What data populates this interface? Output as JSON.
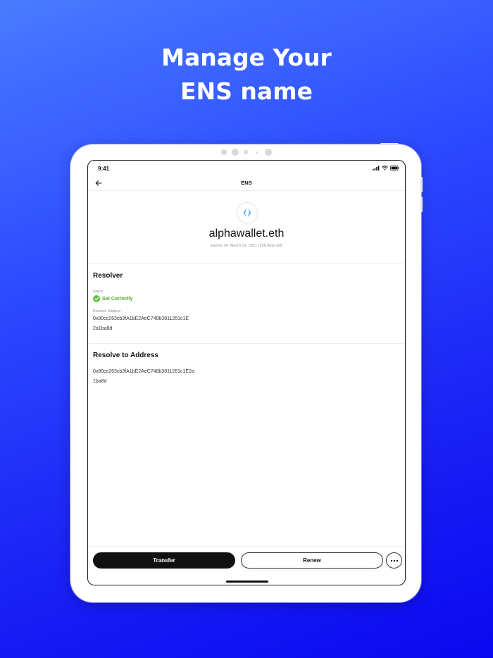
{
  "headline": {
    "line1": "Manage Your",
    "line2": "ENS name"
  },
  "status_bar": {
    "time": "9:41"
  },
  "nav": {
    "title": "ENS",
    "back_icon": "arrow-left-icon"
  },
  "profile": {
    "logo_icon": "ens-logo-icon",
    "name": "alphawallet.eth",
    "expiry": "expires on: March 21, 2021 (256 days left)"
  },
  "resolver": {
    "title": "Resolver",
    "status_label": "Status",
    "status_value": "Set Correctly",
    "status_color": "#4caf32",
    "address_label": "Resolver Address",
    "address_line1": "0x80cc263cb3fA1bE2AeC748b3811261c1E",
    "address_line2": "2a1ba8d"
  },
  "resolve_to": {
    "title": "Resolve to Address",
    "address_line1": "0x80cc263cb3fA1bE2AeC748b3811261c1E2a",
    "address_line2": "1ba8d"
  },
  "actions": {
    "transfer_label": "Transfer",
    "renew_label": "Renew",
    "more_icon": "more-horizontal-icon"
  },
  "colors": {
    "background_start": "#4a7bff",
    "background_end": "#0a08f0",
    "primary_button": "#111111",
    "success": "#5cc23f"
  }
}
